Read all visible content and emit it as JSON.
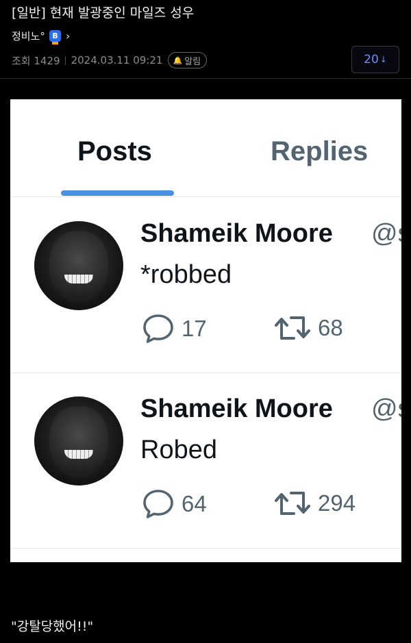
{
  "post": {
    "title": "[일반] 현재 발광중인 마일즈 성우",
    "author": "정비노°",
    "author_badge_letter": "B",
    "views": "조회 1429",
    "date": "2024.03.11 09:21",
    "alarm_label": "알림",
    "comment_count": "20",
    "caption": "\"강탈당했어!!\""
  },
  "embedded": {
    "tabs": [
      "Posts",
      "Replies"
    ],
    "active_tab": "Posts",
    "accent": "#4a90e2",
    "tweets": [
      {
        "name": "Shameik Moore",
        "handle": "@s",
        "text": "*robbed",
        "replies": "17",
        "retweets": "68"
      },
      {
        "name": "Shameik Moore",
        "handle": "@s",
        "text": "Robed",
        "replies": "64",
        "retweets": "294"
      }
    ]
  },
  "icons": {
    "reply": "speech-bubble-icon",
    "retweet": "retweet-arrows-icon",
    "bell": "bell-icon",
    "chevron": "chevron-right-icon"
  }
}
